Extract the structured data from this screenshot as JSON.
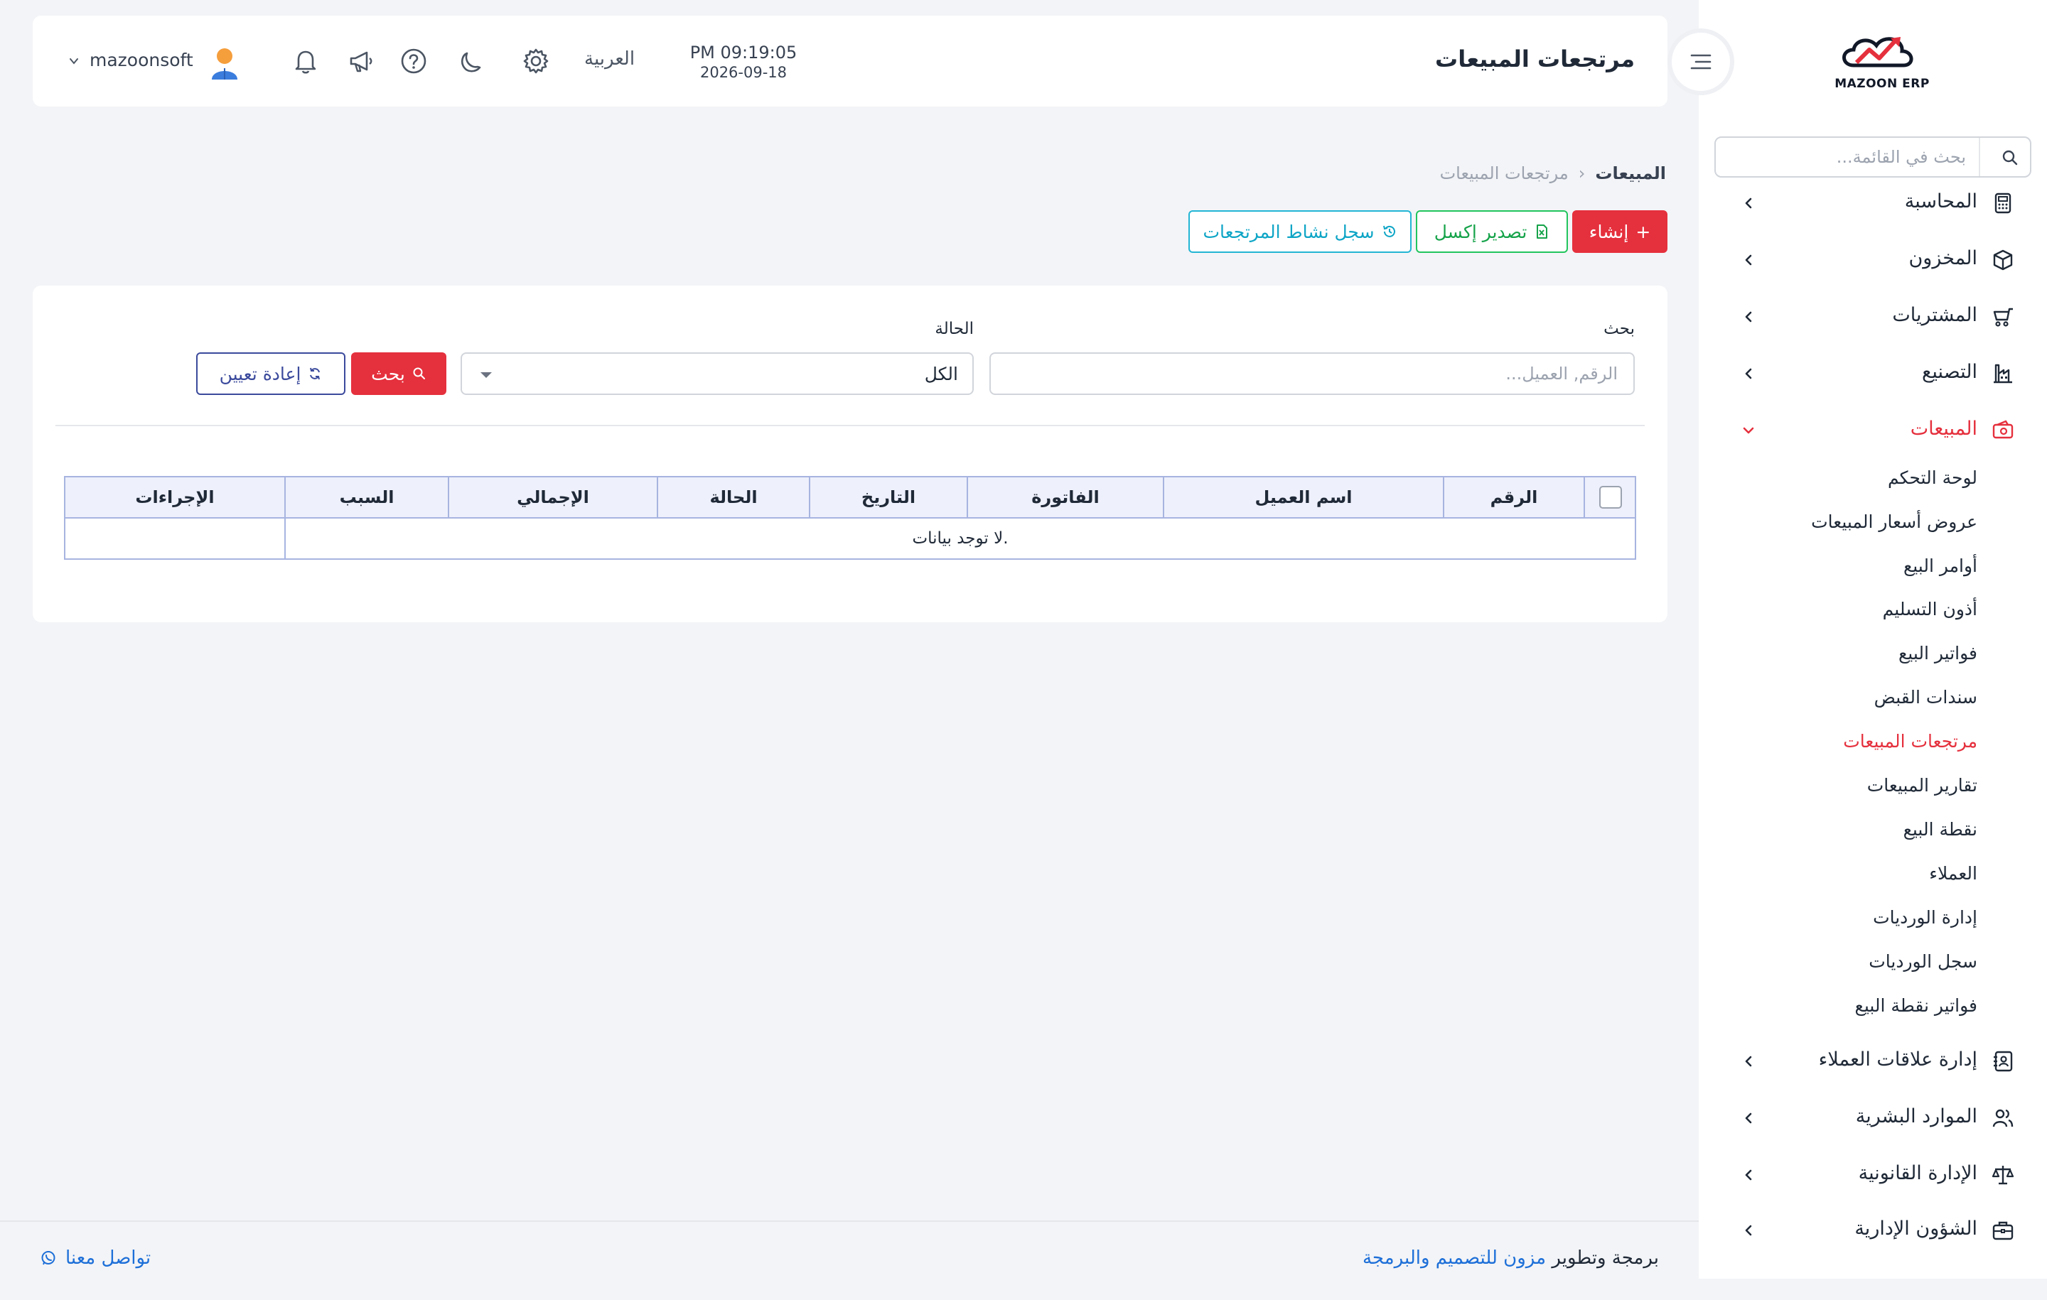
{
  "brand": {
    "logo_text": "MAZOON ERP"
  },
  "sidebar": {
    "search_placeholder": "بحث في القائمة...",
    "items": [
      {
        "label": "المحاسبة",
        "icon": "calculator-icon"
      },
      {
        "label": "المخزون",
        "icon": "box-icon"
      },
      {
        "label": "المشتريات",
        "icon": "cart-icon"
      },
      {
        "label": "التصنيع",
        "icon": "factory-icon"
      },
      {
        "label": "المبيعات",
        "icon": "wallet-icon",
        "active": true
      },
      {
        "label": "إدارة علاقات العملاء",
        "icon": "contacts-icon"
      },
      {
        "label": "الموارد البشرية",
        "icon": "users-icon"
      },
      {
        "label": "الإدارة القانونية",
        "icon": "scale-icon"
      },
      {
        "label": "الشؤون الإدارية",
        "icon": "briefcase-icon"
      }
    ],
    "sales_sub": [
      "لوحة التحكم",
      "عروض أسعار المبيعات",
      "أوامر البيع",
      "أذون التسليم",
      "فواتير البيع",
      "سندات القبض",
      "مرتجعات المبيعات",
      "تقارير المبيعات",
      "نقطة البيع",
      "العملاء",
      "إدارة الورديات",
      "سجل الورديات",
      "فواتير نقطة البيع"
    ]
  },
  "header": {
    "title": "مرتجعات المبيعات",
    "time": "PM 09:19:05",
    "date": "2026-09-18",
    "language": "العربية",
    "username": "mazoonsoft"
  },
  "breadcrumb": {
    "root": "المبيعات",
    "current": "مرتجعات المبيعات"
  },
  "actions": {
    "create": "إنشاء",
    "export_excel": "تصدير إكسل",
    "activity_log": "سجل نشاط المرتجعات"
  },
  "filters": {
    "search_label": "بحث",
    "search_placeholder": "الرقم, العميل...",
    "status_label": "الحالة",
    "status_value": "الكل",
    "search_button": "بحث",
    "reset_button": "إعادة تعيين"
  },
  "table": {
    "columns": [
      "الرقم",
      "اسم العميل",
      "الفاتورة",
      "التاريخ",
      "الحالة",
      "الإجمالي",
      "السبب",
      "الإجراءات"
    ],
    "empty_text": "لا توجد بيانات."
  },
  "footer": {
    "credit_prefix": "برمجة وتطوير",
    "credit_link": "مزون للتصميم والبرمجة",
    "contact": "تواصل معنا"
  },
  "colors": {
    "accent": "#e5303d",
    "success": "#22c55e",
    "info": "#22b5d4",
    "link": "#1d6fd8",
    "reset": "#3b4a9c"
  }
}
